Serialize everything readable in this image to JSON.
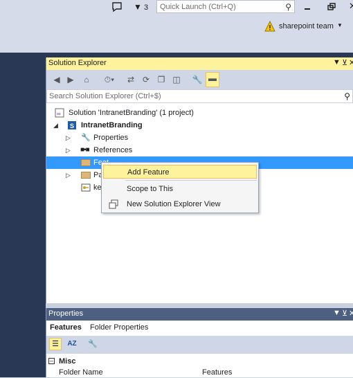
{
  "top_bar": {
    "notification_count": "3",
    "quick_launch_placeholder": "Quick Launch (Ctrl+Q)",
    "user_name": "sharepoint team"
  },
  "solution_explorer": {
    "title": "Solution Explorer",
    "search_placeholder": "Search Solution Explorer (Ctrl+$)",
    "tree": {
      "solution": "Solution 'IntranetBranding' (1 project)",
      "project": "IntranetBranding",
      "properties": "Properties",
      "references": "References",
      "features": "Feat",
      "package": "Pa",
      "key": "ke"
    }
  },
  "context_menu": {
    "items": [
      "Add Feature",
      "Scope to This",
      "New Solution Explorer View"
    ]
  },
  "properties_panel": {
    "title": "Properties",
    "object_name": "Features",
    "object_type": "Folder Properties",
    "category": "Misc",
    "rows": [
      {
        "name": "Folder Name",
        "value": "Features"
      }
    ]
  },
  "colors": {
    "accent_title": "#fff29d",
    "selection": "#3399ff",
    "chrome_dark": "#293955"
  }
}
